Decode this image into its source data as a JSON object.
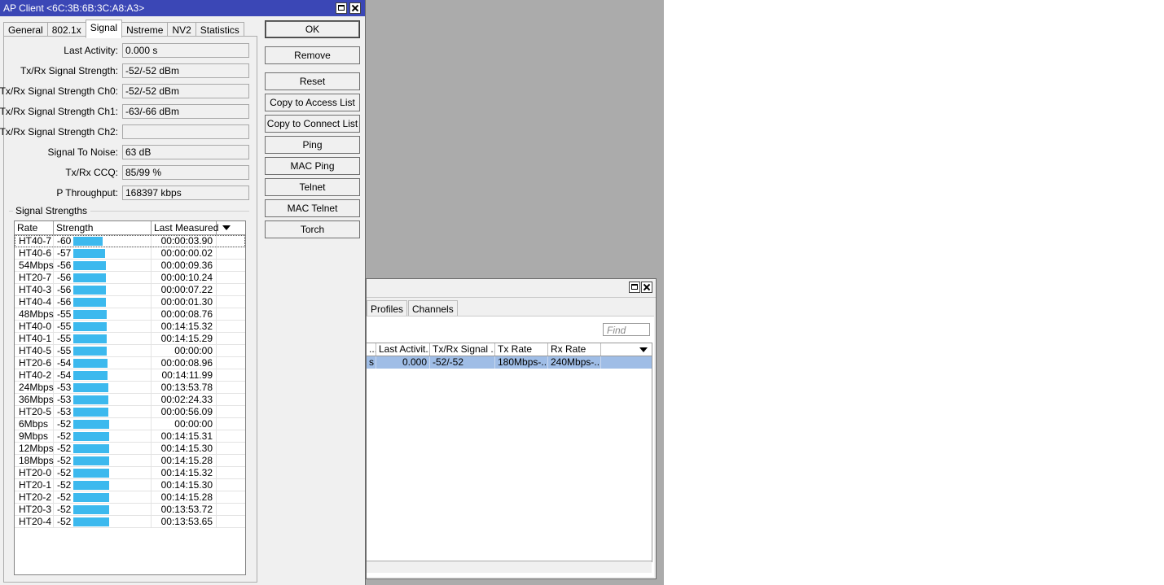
{
  "main_window": {
    "title": "AP Client <6C:3B:6B:3C:A8:A3>",
    "tabs": [
      {
        "label": "General"
      },
      {
        "label": "802.1x"
      },
      {
        "label": "Signal",
        "active": true
      },
      {
        "label": "Nstreme"
      },
      {
        "label": "NV2"
      },
      {
        "label": "Statistics"
      }
    ],
    "fields": [
      {
        "label": "Last Activity:",
        "value": "0.000 s"
      },
      {
        "label": "Tx/Rx Signal Strength:",
        "value": "-52/-52 dBm"
      },
      {
        "label": "Tx/Rx Signal Strength Ch0:",
        "value": "-52/-52 dBm"
      },
      {
        "label": "Tx/Rx Signal Strength Ch1:",
        "value": "-63/-66 dBm"
      },
      {
        "label": "Tx/Rx Signal Strength Ch2:",
        "value": ""
      },
      {
        "label": "Signal To Noise:",
        "value": "63 dB"
      },
      {
        "label": "Tx/Rx CCQ:",
        "value": "85/99 %"
      },
      {
        "label": "P Throughput:",
        "value": "168397 kbps"
      }
    ],
    "signal_group_label": "Signal Strengths",
    "signal_table": {
      "columns": [
        "Rate",
        "Strength",
        "Last Measured"
      ],
      "rows": [
        {
          "rate": "HT40-7",
          "strength": "-60",
          "last": "00:00:03.90"
        },
        {
          "rate": "HT40-6",
          "strength": "-57",
          "last": "00:00:00.02"
        },
        {
          "rate": "54Mbps",
          "strength": "-56",
          "last": "00:00:09.36"
        },
        {
          "rate": "HT20-7",
          "strength": "-56",
          "last": "00:00:10.24"
        },
        {
          "rate": "HT40-3",
          "strength": "-56",
          "last": "00:00:07.22"
        },
        {
          "rate": "HT40-4",
          "strength": "-56",
          "last": "00:00:01.30"
        },
        {
          "rate": "48Mbps",
          "strength": "-55",
          "last": "00:00:08.76"
        },
        {
          "rate": "HT40-0",
          "strength": "-55",
          "last": "00:14:15.32"
        },
        {
          "rate": "HT40-1",
          "strength": "-55",
          "last": "00:14:15.29"
        },
        {
          "rate": "HT40-5",
          "strength": "-55",
          "last": "00:00:00"
        },
        {
          "rate": "HT20-6",
          "strength": "-54",
          "last": "00:00:08.96"
        },
        {
          "rate": "HT40-2",
          "strength": "-54",
          "last": "00:14:11.99"
        },
        {
          "rate": "24Mbps",
          "strength": "-53",
          "last": "00:13:53.78"
        },
        {
          "rate": "36Mbps",
          "strength": "-53",
          "last": "00:02:24.33"
        },
        {
          "rate": "HT20-5",
          "strength": "-53",
          "last": "00:00:56.09"
        },
        {
          "rate": "6Mbps",
          "strength": "-52",
          "last": "00:00:00"
        },
        {
          "rate": "9Mbps",
          "strength": "-52",
          "last": "00:14:15.31"
        },
        {
          "rate": "12Mbps",
          "strength": "-52",
          "last": "00:14:15.30"
        },
        {
          "rate": "18Mbps",
          "strength": "-52",
          "last": "00:14:15.28"
        },
        {
          "rate": "HT20-0",
          "strength": "-52",
          "last": "00:14:15.32"
        },
        {
          "rate": "HT20-1",
          "strength": "-52",
          "last": "00:14:15.30"
        },
        {
          "rate": "HT20-2",
          "strength": "-52",
          "last": "00:14:15.28"
        },
        {
          "rate": "HT20-3",
          "strength": "-52",
          "last": "00:13:53.72"
        },
        {
          "rate": "HT20-4",
          "strength": "-52",
          "last": "00:13:53.65"
        }
      ],
      "bar_color": "#3cb9ee"
    },
    "buttons": [
      "OK",
      "Remove",
      "Reset",
      "Copy to Access List",
      "Copy to Connect List",
      "Ping",
      "MAC Ping",
      "Telnet",
      "MAC Telnet",
      "Torch"
    ]
  },
  "back_window": {
    "tabs": [
      "Profiles",
      "Channels"
    ],
    "find_placeholder": "Find",
    "columns": [
      "...",
      "Last Activit...",
      "Tx/Rx Signal ...",
      "Tx Rate",
      "Rx Rate"
    ],
    "row": {
      "c0": "s",
      "last_activity": "0.000",
      "signal": "-52/-52",
      "tx_rate": "180Mbps-...",
      "rx_rate": "240Mbps-..."
    },
    "selected_color": "#9fbde6"
  },
  "colors": {
    "titlebar": "#3b47b6",
    "desktop": "#ababab"
  }
}
